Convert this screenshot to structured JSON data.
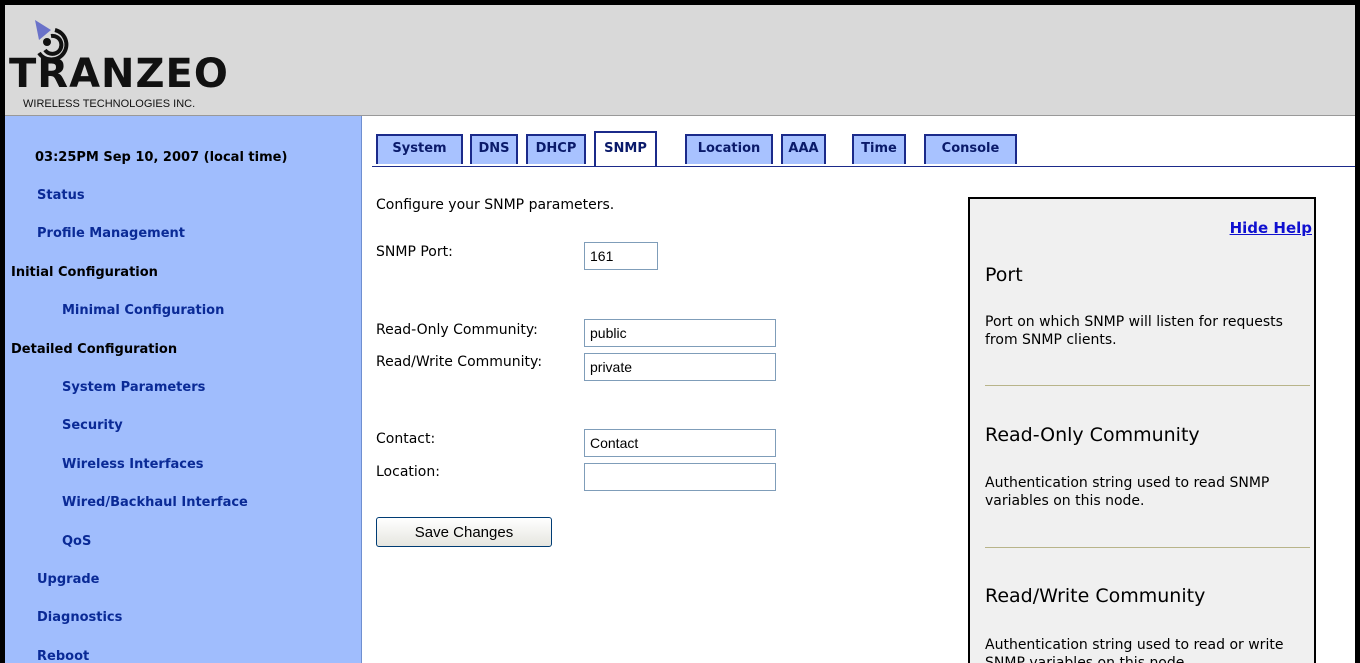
{
  "brand": {
    "name": "TRANZEO",
    "tagline": "WIRELESS TECHNOLOGIES INC."
  },
  "sidebar": {
    "clock": "03:25PM Sep 10, 2007 (local time)",
    "items": [
      {
        "label": "Status"
      },
      {
        "label": "Profile Management"
      },
      {
        "label": "Initial Configuration"
      },
      {
        "label": "Minimal Configuration"
      },
      {
        "label": "Detailed Configuration"
      },
      {
        "label": "System Parameters"
      },
      {
        "label": "Security"
      },
      {
        "label": "Wireless Interfaces"
      },
      {
        "label": "Wired/Backhaul Interface"
      },
      {
        "label": "QoS"
      },
      {
        "label": "Upgrade"
      },
      {
        "label": "Diagnostics"
      },
      {
        "label": "Reboot"
      }
    ]
  },
  "tabs": [
    {
      "label": "System"
    },
    {
      "label": "DNS"
    },
    {
      "label": "DHCP"
    },
    {
      "label": "SNMP",
      "active": true
    },
    {
      "label": "Location"
    },
    {
      "label": "AAA"
    },
    {
      "label": "Time"
    },
    {
      "label": "Console"
    }
  ],
  "form": {
    "intro": "Configure your SNMP parameters.",
    "port_label": "SNMP Port:",
    "port_value": "161",
    "ro_label": "Read-Only Community:",
    "ro_value": "public",
    "rw_label": "Read/Write Community:",
    "rw_value": "private",
    "contact_label": "Contact:",
    "contact_value": "Contact",
    "location_label": "Location:",
    "location_value": "",
    "save_label": "Save Changes"
  },
  "help": {
    "hide_label": "Hide Help",
    "sections": [
      {
        "title": "Port",
        "desc": "Port on which SNMP will listen for requests from SNMP clients."
      },
      {
        "title": "Read-Only Community",
        "desc": "Authentication string used to read SNMP variables on this node."
      },
      {
        "title": "Read/Write Community",
        "desc": "Authentication string used to read or write SNMP variables on this node."
      }
    ]
  },
  "colors": {
    "sidebar_bg": "#a0bdfd",
    "nav_link": "#0a2a96",
    "tab_bg": "#a8c2ff",
    "tab_border": "#1b2a8a",
    "help_link": "#1010d0"
  }
}
